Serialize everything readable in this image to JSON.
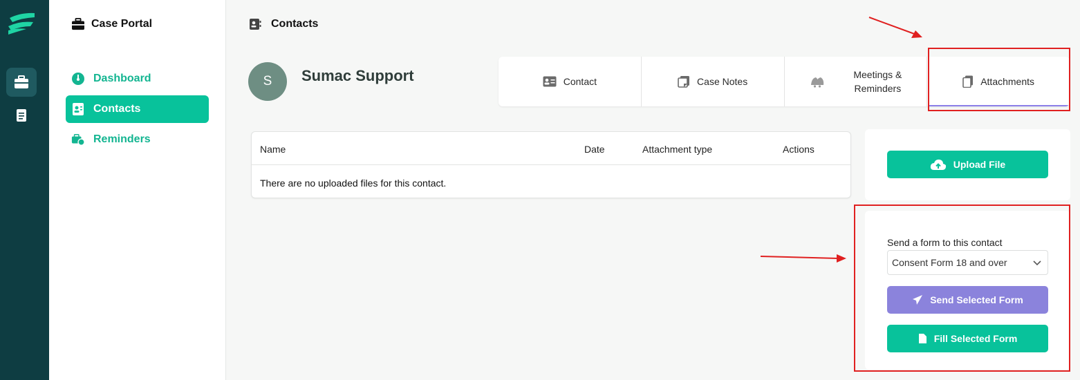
{
  "nav": {
    "brand": "Case Portal",
    "items": [
      {
        "label": "Dashboard",
        "icon": "dashboard-gauge-icon"
      },
      {
        "label": "Contacts",
        "icon": "contacts-card-icon"
      },
      {
        "label": "Reminders",
        "icon": "reminders-icon"
      }
    ]
  },
  "page": {
    "title": "Contacts"
  },
  "contact": {
    "initial": "S",
    "name": "Sumac Support"
  },
  "tabs": [
    {
      "label": "Contact",
      "icon": "id-card-icon"
    },
    {
      "label": "Case Notes",
      "icon": "notes-icon"
    },
    {
      "label": "Meetings &\nReminders",
      "icon": "bells-icon"
    },
    {
      "label": "Attachments",
      "icon": "documents-icon"
    }
  ],
  "table": {
    "headers": [
      "Name",
      "Date",
      "Attachment type",
      "Actions"
    ],
    "empty_message": "There are no uploaded files for this contact."
  },
  "upload": {
    "button_label": "Upload File"
  },
  "form": {
    "label": "Send a form to this contact",
    "selected": "Consent Form 18 and over",
    "send_label": "Send Selected Form",
    "fill_label": "Fill Selected Form"
  },
  "colors": {
    "rail": "#0e3d42",
    "accent": "#08c29b",
    "purple": "#8b83dc",
    "annotation": "#e02020"
  }
}
